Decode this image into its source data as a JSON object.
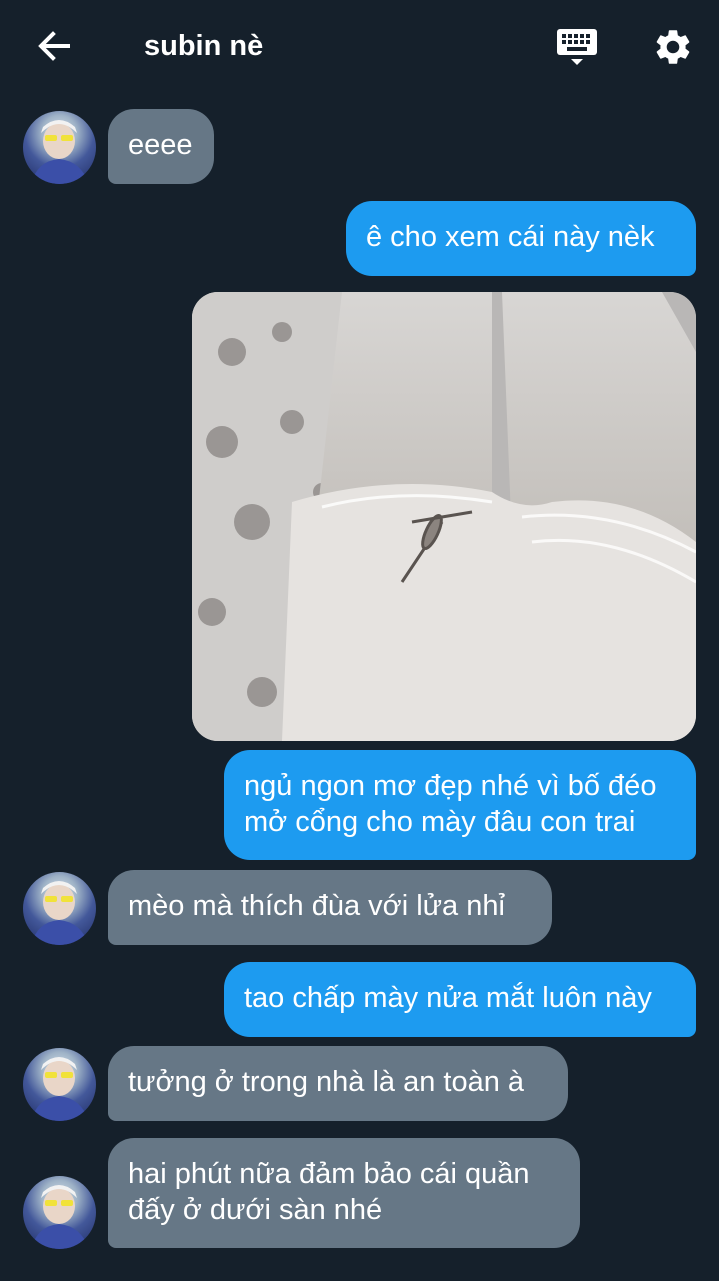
{
  "header": {
    "title": "subin nè"
  },
  "messages": [
    {
      "side": "in",
      "text": "eeee"
    },
    {
      "side": "out",
      "text": "ê cho xem cái này nèk"
    },
    {
      "side": "out",
      "type": "image"
    },
    {
      "side": "out",
      "lines": [
        "ngủ ngon mơ đẹp nhé vì bố đéo",
        "mở cổng cho mày đâu con trai"
      ]
    },
    {
      "side": "in",
      "text": "mèo mà thích đùa với lửa nhỉ"
    },
    {
      "side": "out",
      "text": "tao chấp mày nửa mắt luôn này"
    },
    {
      "side": "in",
      "text": "tưởng ở trong nhà là an toàn à"
    },
    {
      "side": "in",
      "lines": [
        "hai phút nữa đảm bảo cái quần",
        "đấy ở dưới sàn nhé"
      ]
    }
  ],
  "colors": {
    "background": "#15202b",
    "incoming_bubble": "#667786",
    "outgoing_bubble": "#1d9bf0",
    "text": "#ffffff"
  },
  "icons": {
    "back": "arrow-left-icon",
    "keyboard": "keyboard-icon",
    "settings": "gear-icon"
  }
}
